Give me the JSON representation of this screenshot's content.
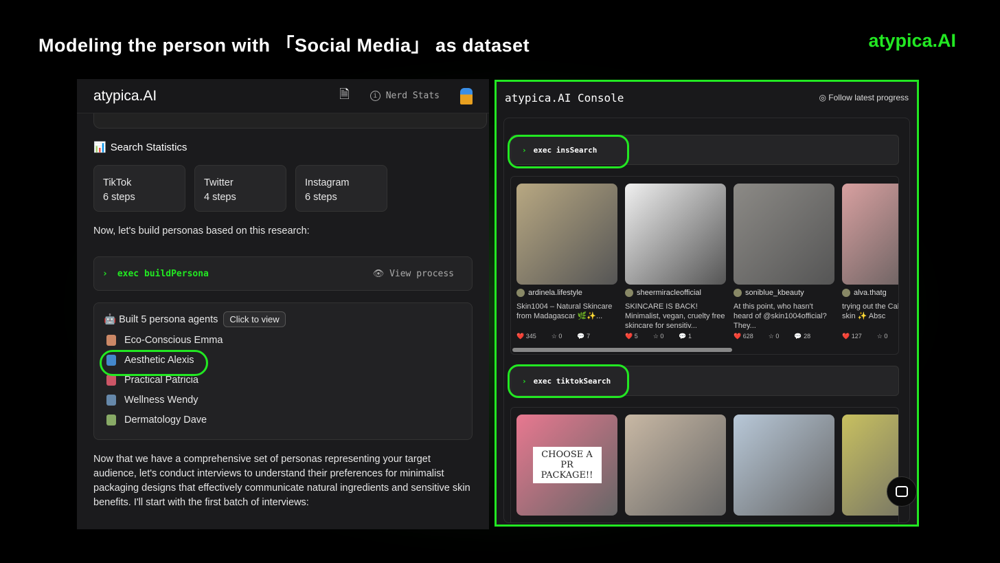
{
  "headline": "Modeling the person with 「Social Media」 as dataset",
  "brand": "atypica.AI",
  "left": {
    "logo": "atypica.AI",
    "nerd_stats": "Nerd Stats",
    "stats_title": "Search Statistics",
    "stats": [
      {
        "platform": "TikTok",
        "steps": "6 steps"
      },
      {
        "platform": "Twitter",
        "steps": "4 steps"
      },
      {
        "platform": "Instagram",
        "steps": "6 steps"
      }
    ],
    "intro": "Now, let's build personas based on this research:",
    "exec_label": "exec buildPersona",
    "view_process": "View process",
    "built_title": "Built 5 persona agents",
    "click_to_view": "Click to view",
    "personas": [
      "Eco-Conscious Emma",
      "Aesthetic Alexis",
      "Practical Patricia",
      "Wellness Wendy",
      "Dermatology Dave"
    ],
    "persona_colors": [
      "#c86",
      "#48c",
      "#c56",
      "#68a",
      "#8a6"
    ],
    "outro": "Now that we have a comprehensive set of personas representing your target audience, let's conduct interviews to understand their preferences for minimalist packaging designs that effectively communicate natural ingredients and sensitive skin benefits. I'll start with the first batch of interviews:"
  },
  "console": {
    "title": "atypica.AI Console",
    "follow": "Follow latest progress",
    "ins_exec": "exec insSearch",
    "tiktok_exec": "exec tiktokSearch",
    "ins_posts": [
      {
        "user": "ardinela.lifestyle",
        "caption": "Skin1004 – Natural Skincare from Madagascar 🌿✨...",
        "likes": "345",
        "stars": "0",
        "comments": "7",
        "color": "#b8a882"
      },
      {
        "user": "sheermiracleofficial",
        "caption": "SKINCARE IS BACK! Minimalist, vegan, cruelty free skincare for sensitiv...",
        "likes": "5",
        "stars": "0",
        "comments": "1",
        "color": "#f0f0f0"
      },
      {
        "user": "soniblue_kbeauty",
        "caption": "At this point, who hasn't heard of @skin1004official? They...",
        "likes": "628",
        "stars": "0",
        "comments": "28",
        "color": "#8c8a86"
      },
      {
        "user": "alva.thatg",
        "caption": "trying out the Calming line skin ✨ Absc",
        "likes": "127",
        "stars": "0",
        "comments": "",
        "color": "#d8a0a0"
      }
    ],
    "tiktok_posts": [
      {
        "overlay": "CHOOSE A PR PACKAGE!!",
        "color": "#e87890"
      },
      {
        "overlay": "",
        "color": "#c8b8a4"
      },
      {
        "overlay": "",
        "color": "#b8c8d8"
      },
      {
        "overlay": "",
        "color": "#c8c060"
      }
    ]
  }
}
